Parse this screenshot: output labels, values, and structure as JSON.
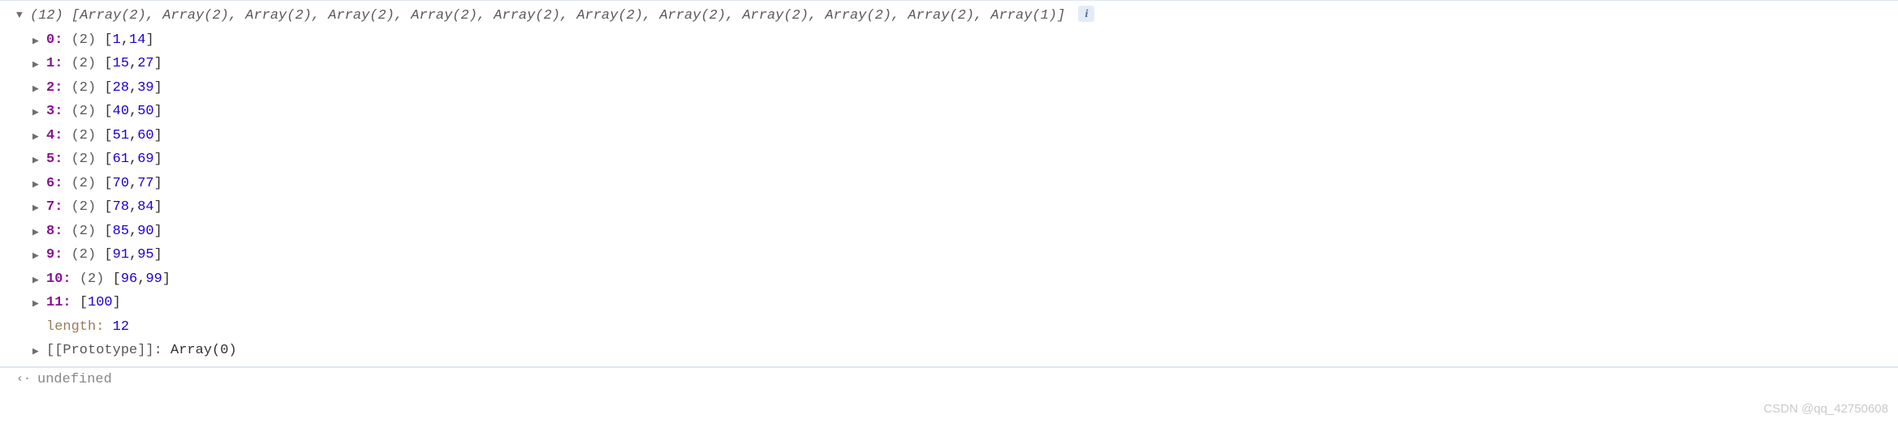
{
  "summary": {
    "count": "(12)",
    "preview": "[Array(2), Array(2), Array(2), Array(2), Array(2), Array(2), Array(2), Array(2), Array(2), Array(2), Array(2), Array(1)]"
  },
  "items": [
    {
      "index": "0",
      "len": "(2)",
      "v0": "1",
      "v1": "14"
    },
    {
      "index": "1",
      "len": "(2)",
      "v0": "15",
      "v1": "27"
    },
    {
      "index": "2",
      "len": "(2)",
      "v0": "28",
      "v1": "39"
    },
    {
      "index": "3",
      "len": "(2)",
      "v0": "40",
      "v1": "50"
    },
    {
      "index": "4",
      "len": "(2)",
      "v0": "51",
      "v1": "60"
    },
    {
      "index": "5",
      "len": "(2)",
      "v0": "61",
      "v1": "69"
    },
    {
      "index": "6",
      "len": "(2)",
      "v0": "70",
      "v1": "77"
    },
    {
      "index": "7",
      "len": "(2)",
      "v0": "78",
      "v1": "84"
    },
    {
      "index": "8",
      "len": "(2)",
      "v0": "85",
      "v1": "90"
    },
    {
      "index": "9",
      "len": "(2)",
      "v0": "91",
      "v1": "95"
    },
    {
      "index": "10",
      "len": "(2)",
      "v0": "96",
      "v1": "99"
    }
  ],
  "singleItem": {
    "index": "11",
    "v0": "100"
  },
  "length": {
    "label": "length",
    "value": "12"
  },
  "prototype": {
    "label": "[[Prototype]]",
    "value": "Array(0)"
  },
  "undefinedText": "undefined",
  "infoIcon": "i",
  "watermark": "CSDN @qq_42750608"
}
